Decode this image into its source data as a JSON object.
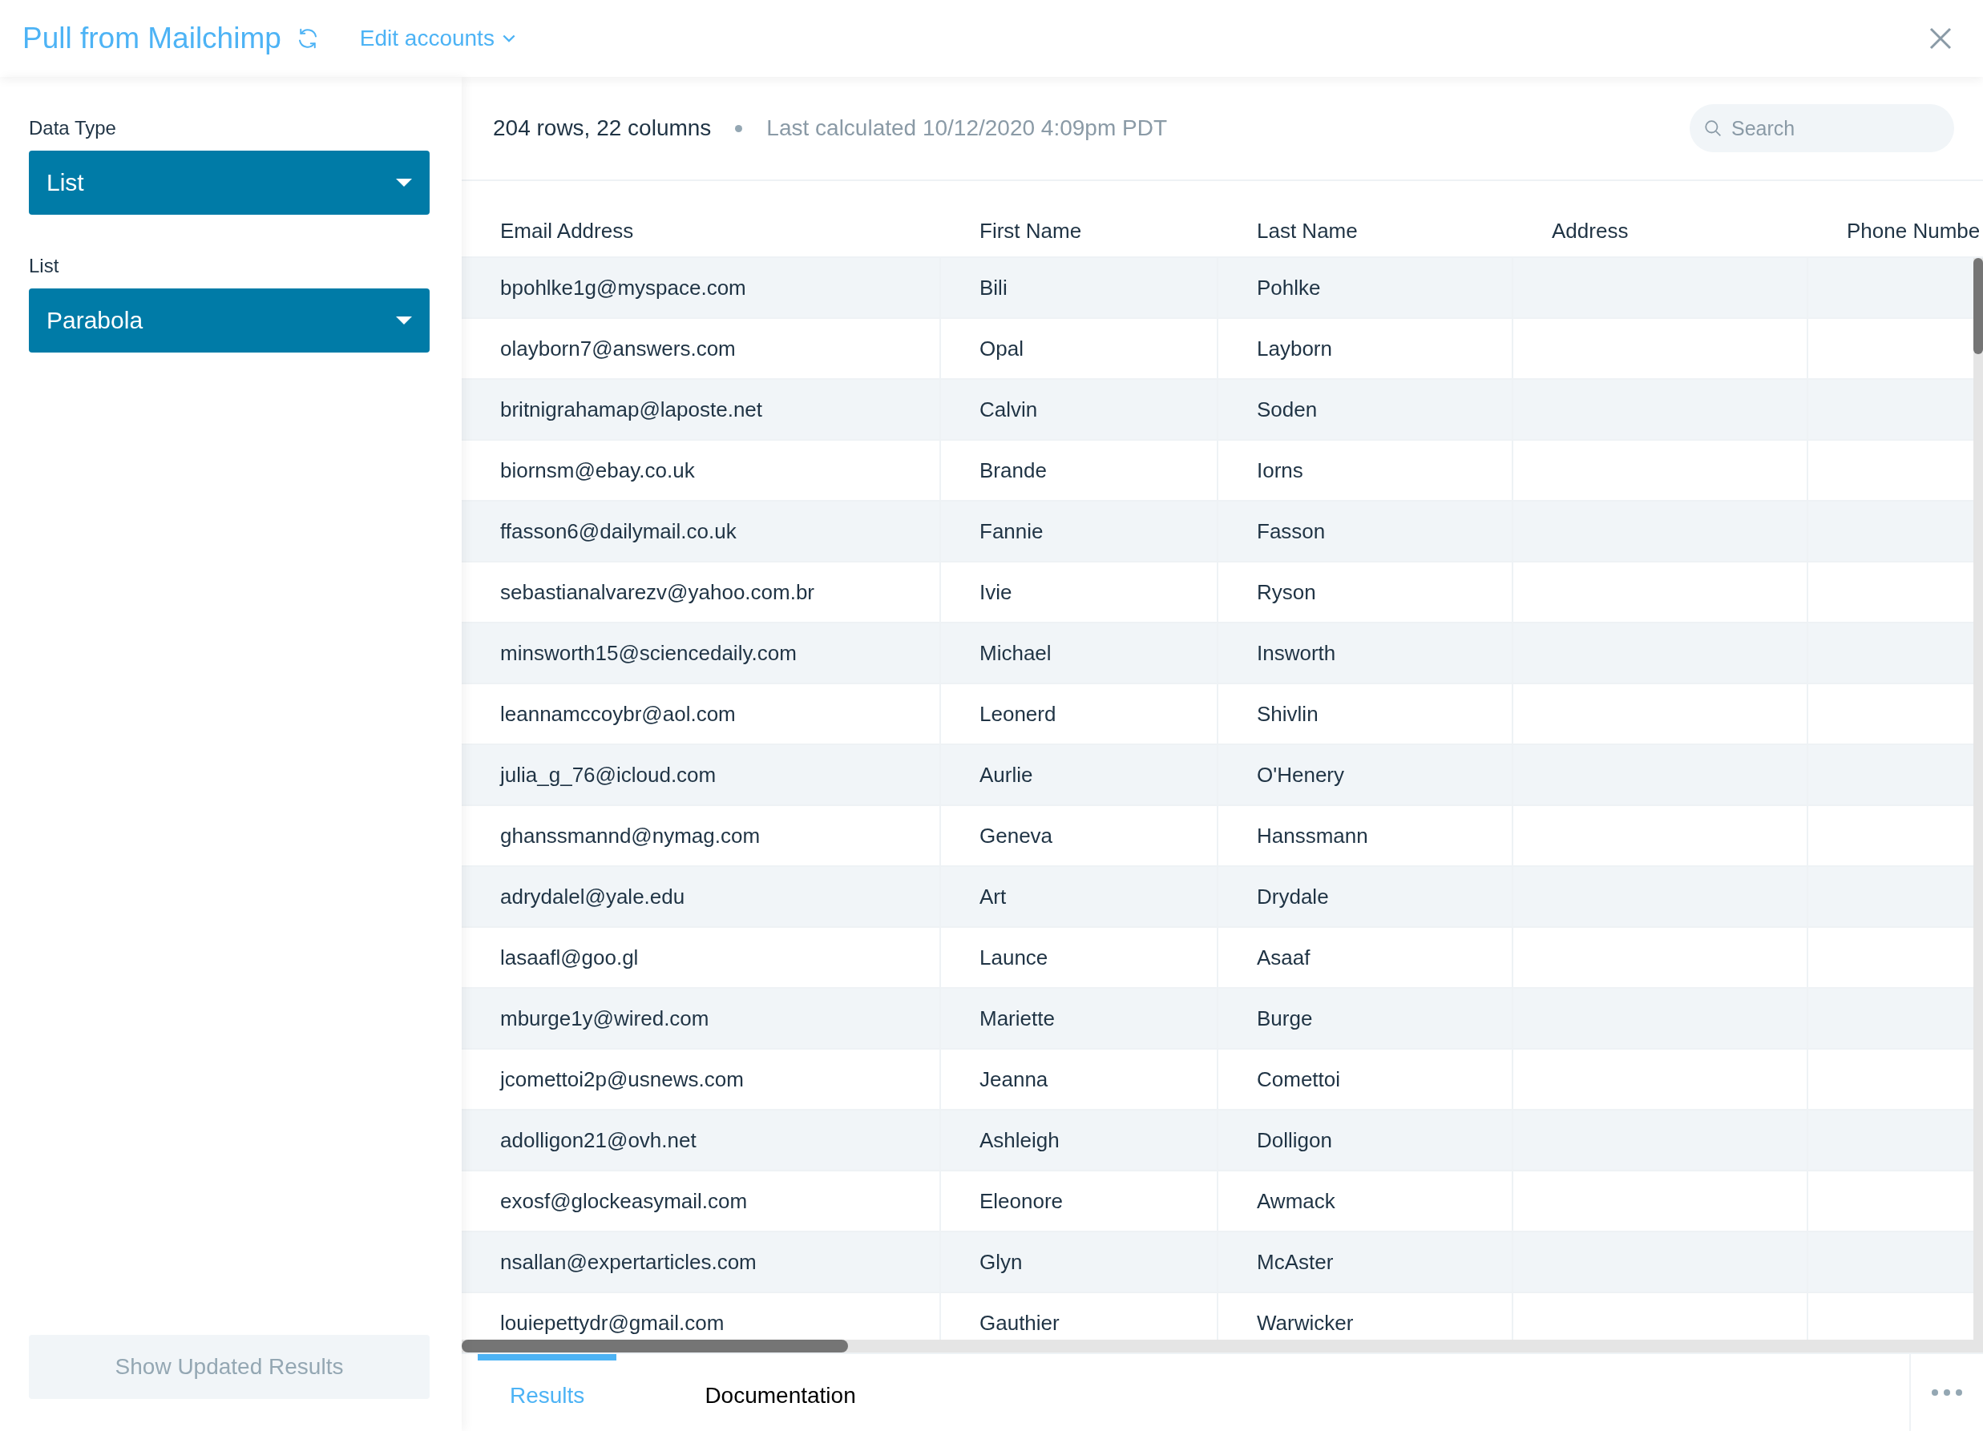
{
  "header": {
    "title": "Pull from Mailchimp",
    "edit_accounts": "Edit accounts"
  },
  "sidebar": {
    "fields": [
      {
        "label": "Data Type",
        "value": "List"
      },
      {
        "label": "List",
        "value": "Parabola"
      }
    ],
    "button": {
      "label": "Show Updated Results",
      "disabled": true
    }
  },
  "toolbar": {
    "summary": "204 rows, 22 columns",
    "last_calculated": "Last calculated 10/12/2020 4:09pm PDT",
    "search": {
      "placeholder": "Search"
    }
  },
  "table": {
    "columns": [
      "Email Address",
      "First Name",
      "Last Name",
      "Address",
      "Phone Numbe"
    ],
    "rows": [
      [
        "bpohlke1g@myspace.com",
        "Bili",
        "Pohlke"
      ],
      [
        "olayborn7@answers.com",
        "Opal",
        "Layborn"
      ],
      [
        "britnigrahamap@laposte.net",
        "Calvin",
        "Soden"
      ],
      [
        "biornsm@ebay.co.uk",
        "Brande",
        "Iorns"
      ],
      [
        "ffasson6@dailymail.co.uk",
        "Fannie",
        "Fasson"
      ],
      [
        "sebastianalvarezv@yahoo.com.br",
        "Ivie",
        "Ryson"
      ],
      [
        "minsworth15@sciencedaily.com",
        "Michael",
        "Insworth"
      ],
      [
        "leannamccoybr@aol.com",
        "Leonerd",
        "Shivlin"
      ],
      [
        "julia_g_76@icloud.com",
        "Aurlie",
        "O'Henery"
      ],
      [
        "ghanssmannd@nymag.com",
        "Geneva",
        "Hanssmann"
      ],
      [
        "adrydalel@yale.edu",
        "Art",
        "Drydale"
      ],
      [
        "lasaafl@goo.gl",
        "Launce",
        "Asaaf"
      ],
      [
        "mburge1y@wired.com",
        "Mariette",
        "Burge"
      ],
      [
        "jcomettoi2p@usnews.com",
        "Jeanna",
        "Comettoi"
      ],
      [
        "adolligon21@ovh.net",
        "Ashleigh",
        "Dolligon"
      ],
      [
        "exosf@glockeasymail.com",
        "Eleonore",
        "Awmack"
      ],
      [
        "nsallan@expertarticles.com",
        "Glyn",
        "McAster"
      ],
      [
        "louiepettydr@gmail.com",
        "Gauthier",
        "Warwicker"
      ]
    ]
  },
  "tabs": [
    {
      "label": "Results",
      "selected": true
    },
    {
      "label": "Documentation",
      "selected": false
    }
  ]
}
